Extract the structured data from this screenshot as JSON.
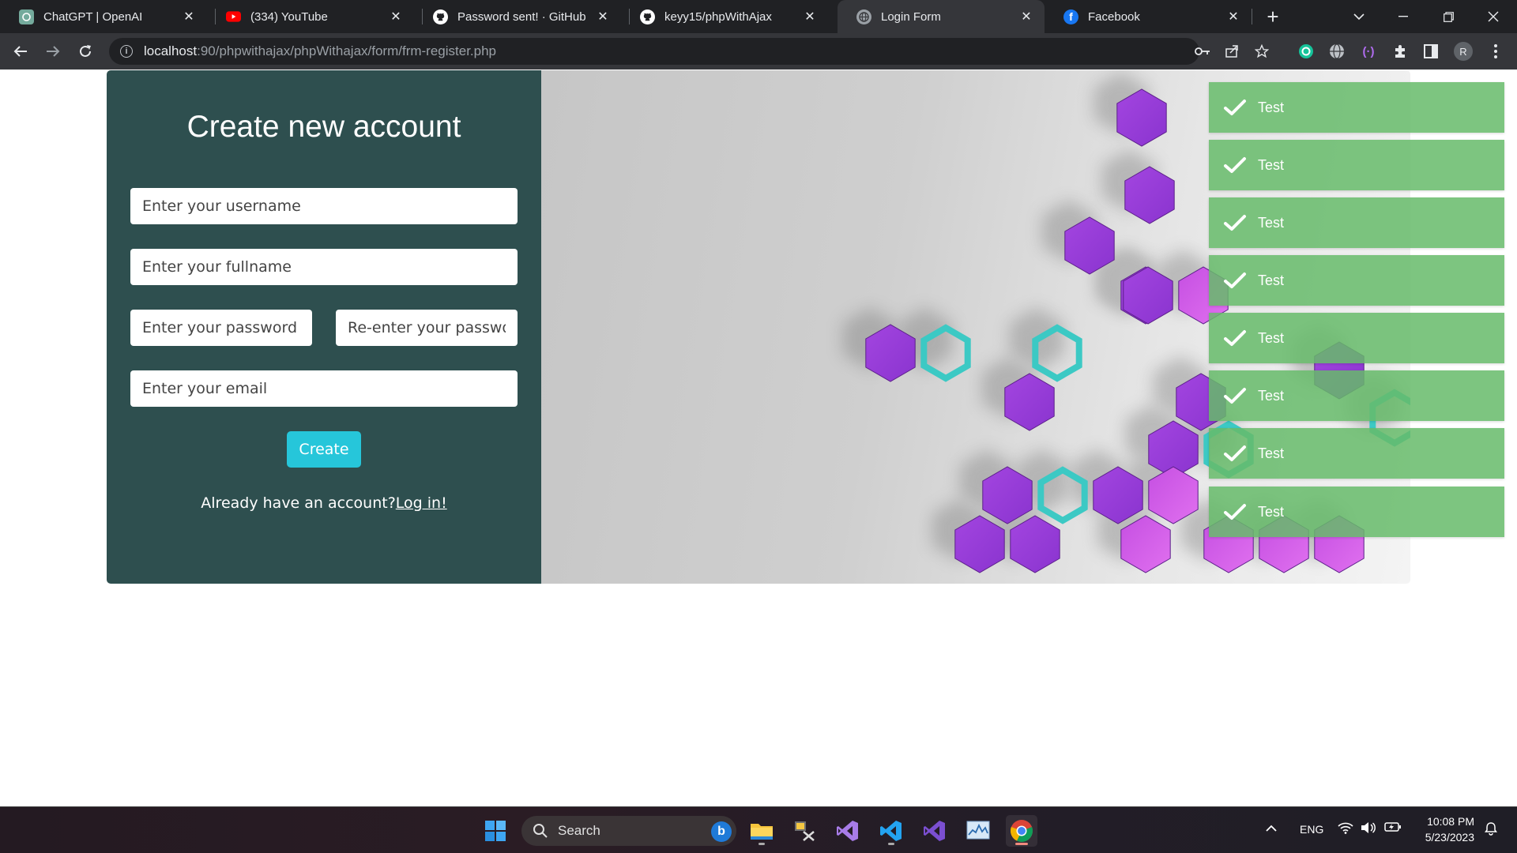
{
  "browser": {
    "tabs": [
      {
        "title": "ChatGPT | OpenAI",
        "icon": "openai-icon",
        "active": false
      },
      {
        "title": "(334) YouTube",
        "icon": "youtube-icon",
        "active": false
      },
      {
        "title": "Password sent! · GitHub",
        "icon": "github-icon",
        "active": false
      },
      {
        "title": "keyy15/phpWithAjax",
        "icon": "github-icon",
        "active": false
      },
      {
        "title": "Login Form",
        "icon": "globe-icon",
        "active": true
      },
      {
        "title": "Facebook",
        "icon": "facebook-icon",
        "active": false
      }
    ],
    "url_host": "localhost",
    "url_rest": ":90/phpwithajax/phpWithajax/form/frm-register.php",
    "profile_initial": "R"
  },
  "form": {
    "heading": "Create new account",
    "username_placeholder": "Enter your username",
    "fullname_placeholder": "Enter your fullname",
    "password_placeholder": "Enter your password",
    "repassword_placeholder": "Re-enter your password",
    "email_placeholder": "Enter your email",
    "create_label": "Create",
    "login_prompt": "Already have an account?",
    "login_link": "Log in!"
  },
  "toasts": [
    "Test",
    "Test",
    "Test",
    "Test",
    "Test",
    "Test",
    "Test",
    "Test"
  ],
  "taskbar": {
    "search_label": "Search",
    "language": "ENG",
    "time": "10:08 PM",
    "date": "5/23/2023"
  },
  "colors": {
    "form_panel": "#2e4f4f",
    "create_button": "#26c6da",
    "toast": "#66bb6a",
    "hex_purple": "#9a3ddb",
    "hex_magenta": "#d65ce6",
    "hex_teal": "#3cc9c4"
  }
}
